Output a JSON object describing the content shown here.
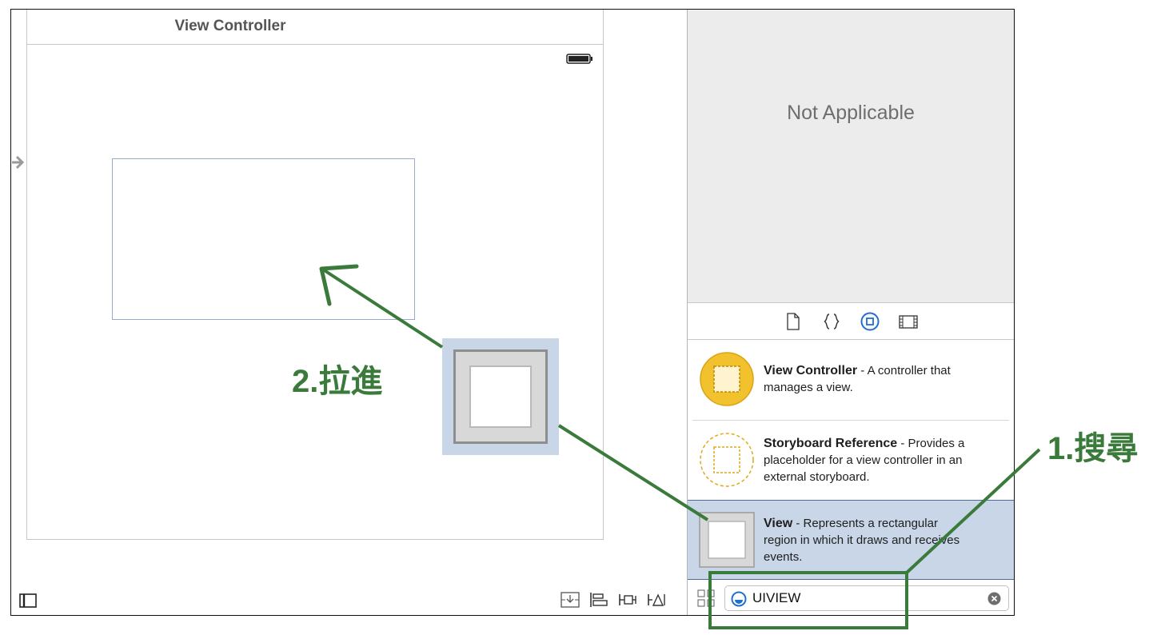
{
  "scene": {
    "title": "View Controller"
  },
  "inspector": {
    "empty_text": "Not Applicable"
  },
  "library_tabs": [
    "file-template-icon",
    "code-snippet-icon",
    "object-library-icon",
    "media-library-icon"
  ],
  "library_items": [
    {
      "name": "View Controller",
      "separator": " - ",
      "description_lines": [
        "A controller that",
        "manages a view."
      ],
      "first_line_rest": "A controller that",
      "line2": "manages a view.",
      "line3": ""
    },
    {
      "name": "Storyboard Reference",
      "separator": " - ",
      "first_line_rest": "Provides a",
      "line2": "placeholder for a view controller in an",
      "line3": "external storyboard."
    },
    {
      "name": "View",
      "separator": " - ",
      "first_line_rest": "Represents a rectangular",
      "line2": "region in which it draws and receives",
      "line3": "events."
    }
  ],
  "search": {
    "value": "UIVIEW"
  },
  "annotations": {
    "step1": "1.搜尋",
    "step2": "2.拉進"
  },
  "colors": {
    "annotation": "#3a7a3a",
    "selection": "#c8d6e8",
    "vc_icon": "#f2c12e"
  }
}
